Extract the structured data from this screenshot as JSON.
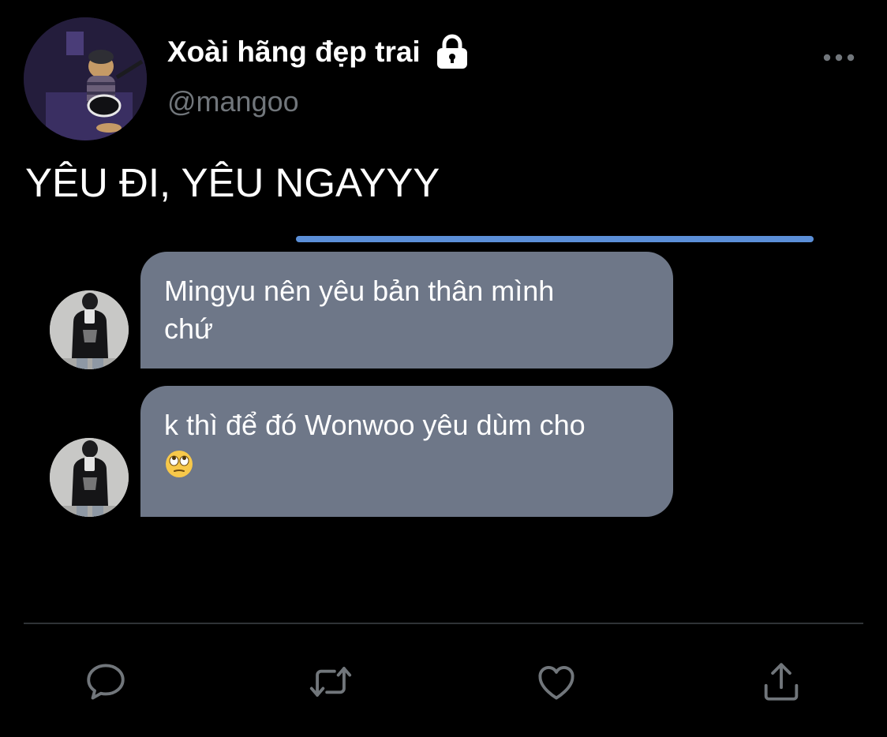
{
  "tweet": {
    "author": {
      "display_name": "Xoài hãng đẹp trai",
      "handle": "@mangoo",
      "avatar_icon": "cat-playing-guitar-avatar",
      "lock_icon": "lock-icon"
    },
    "more_icon": "more-horizontal-icon",
    "text": "YÊU ĐI, YÊU NGAYYY",
    "embedded_chat": {
      "accent_color": "#5b8fd8",
      "bubble_color": "#6e7788",
      "messages": [
        {
          "avatar_icon": "person-mirror-selfie-avatar",
          "line1": "Mingyu nên yêu bản thân mình",
          "line2": "chứ"
        },
        {
          "avatar_icon": "person-mirror-selfie-avatar",
          "line1": "k thì để đó Wonwoo yêu dùm cho",
          "emoji": "face-with-rolling-eyes"
        }
      ]
    },
    "actions": [
      "reply-icon",
      "retweet-icon",
      "like-icon",
      "share-icon"
    ]
  },
  "colors": {
    "background": "#000000",
    "text_primary": "#ffffff",
    "text_secondary": "#71767b",
    "divider": "#2f3336"
  }
}
